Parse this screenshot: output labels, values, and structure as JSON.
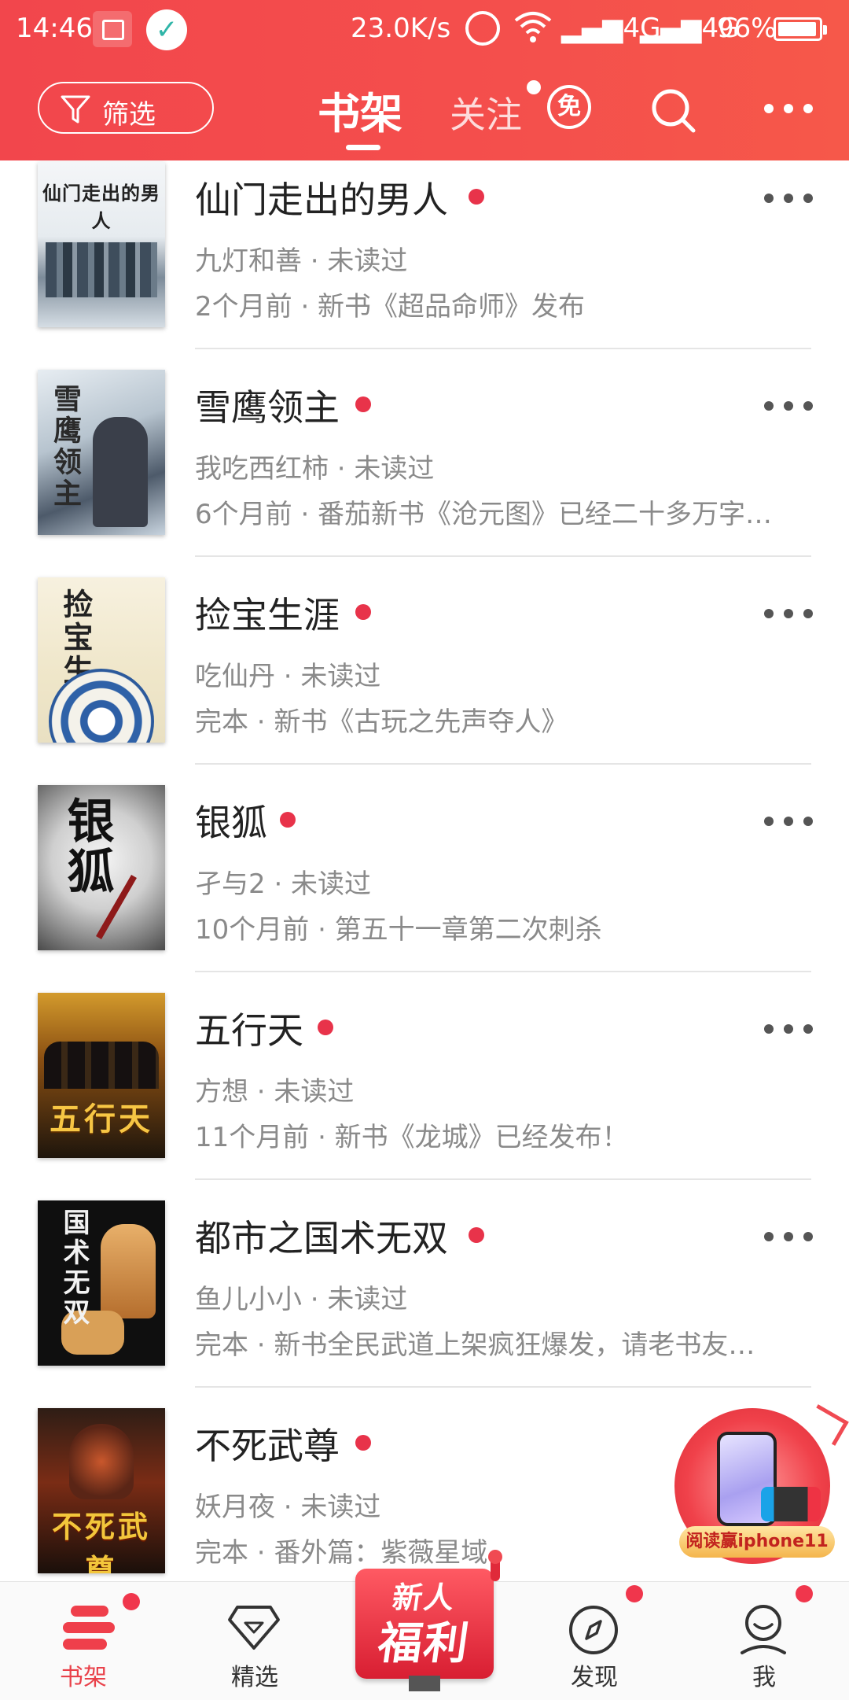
{
  "status_bar": {
    "time": "14:46",
    "speed": "23.0K/s",
    "network_1": "4G",
    "network_2": "4G",
    "battery": "96%",
    "icons": [
      "screenshot-icon",
      "check-icon",
      "alarm-icon",
      "wifi-icon",
      "signal-icon",
      "battery-icon"
    ]
  },
  "header": {
    "filter_label": "筛选",
    "tab_bookshelf": "书架",
    "tab_follow": "关注",
    "free_badge": "免",
    "icons": [
      "funnel-icon",
      "search-icon",
      "more-icon"
    ],
    "accent": "#f2464c"
  },
  "books": [
    {
      "title": "仙门走出的男人",
      "cover_text": "仙门走出的男人",
      "author_line": "九灯和善 · 未读过",
      "update_line": "2个月前 · 新书《超品命师》发布"
    },
    {
      "title": "雪鹰领主",
      "cover_text": "雪鹰领主",
      "author_line": "我吃西红柿 · 未读过",
      "update_line": "6个月前 · 番茄新书《沧元图》已经二十多万字…"
    },
    {
      "title": "捡宝生涯",
      "cover_text": "捡宝生涯",
      "author_line": "吃仙丹 · 未读过",
      "update_line": "完本 · 新书《古玩之先声夺人》"
    },
    {
      "title": "银狐",
      "cover_text": "银狐",
      "author_line": "孑与2 · 未读过",
      "update_line": "10个月前 · 第五十一章第二次刺杀"
    },
    {
      "title": "五行天",
      "cover_text": "五行天",
      "author_line": "方想 · 未读过",
      "update_line": "11个月前 · 新书《龙城》已经发布！"
    },
    {
      "title": "都市之国术无双",
      "cover_text": "国术无双",
      "author_line": "鱼儿小小 · 未读过",
      "update_line": "完本 · 新书全民武道上架疯狂爆发，请老书友…"
    },
    {
      "title": "不死武尊",
      "cover_text": "不死武尊",
      "author_line": "妖月夜 · 未读过",
      "update_line": "完本 · 番外篇：紫薇星域"
    }
  ],
  "promo": {
    "label": "阅读赢iphone11"
  },
  "bottom_nav": {
    "items": [
      {
        "label": "书架",
        "icon": "bookshelf-icon",
        "active": true,
        "badge": true
      },
      {
        "label": "精选",
        "icon": "gem-icon",
        "active": false,
        "badge": false
      },
      {
        "label": "发现",
        "icon": "compass-icon",
        "active": false,
        "badge": true
      },
      {
        "label": "我",
        "icon": "user-icon",
        "active": false,
        "badge": true
      }
    ],
    "welfare_line1": "新人",
    "welfare_line2": "福利",
    "active_color": "#e9414a"
  }
}
